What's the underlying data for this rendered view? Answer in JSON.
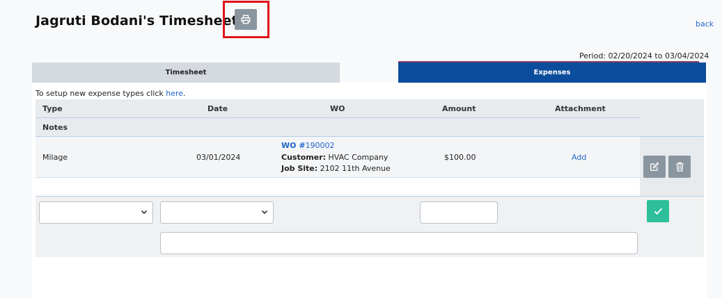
{
  "page": {
    "title": "Jagruti Bodani's Timesheet",
    "back_label": "back",
    "period": "Period: 02/20/2024 to 03/04/2024"
  },
  "icons": {
    "print": "print-icon",
    "edit": "edit-icon",
    "delete": "trash-icon",
    "chevron": "chevron-down-icon",
    "confirm": "check-icon"
  },
  "tabs": {
    "timesheet": "Timesheet",
    "expenses": "Expenses"
  },
  "setup": {
    "text": "To setup new expense types click ",
    "link": "here",
    "suffix": "."
  },
  "table": {
    "headers": {
      "type": "Type",
      "date": "Date",
      "wo": "WO",
      "amount": "Amount",
      "attachment": "Attachment",
      "notes": "Notes"
    },
    "rows": [
      {
        "type": "Milage",
        "date": "03/01/2024",
        "wo_label": "WO #",
        "wo_number": "190002",
        "customer_label": "Customer:",
        "customer": " HVAC Company",
        "job_site_label": "Job Site:",
        "job_site": " 2102 11th Avenue",
        "amount": "$100.00",
        "attachment_action": "Add",
        "notes": ""
      }
    ]
  },
  "new_entry": {
    "type_value": "",
    "date_value": "",
    "amount_value": "",
    "notes_value": ""
  },
  "colors": {
    "active_tab": "#0b4c9c",
    "inactive_tab": "#d4dae0",
    "link": "#2266cc",
    "confirm_button": "#2cbf9a",
    "icon_button": "#8a969f",
    "highlight": "#e0111b"
  }
}
